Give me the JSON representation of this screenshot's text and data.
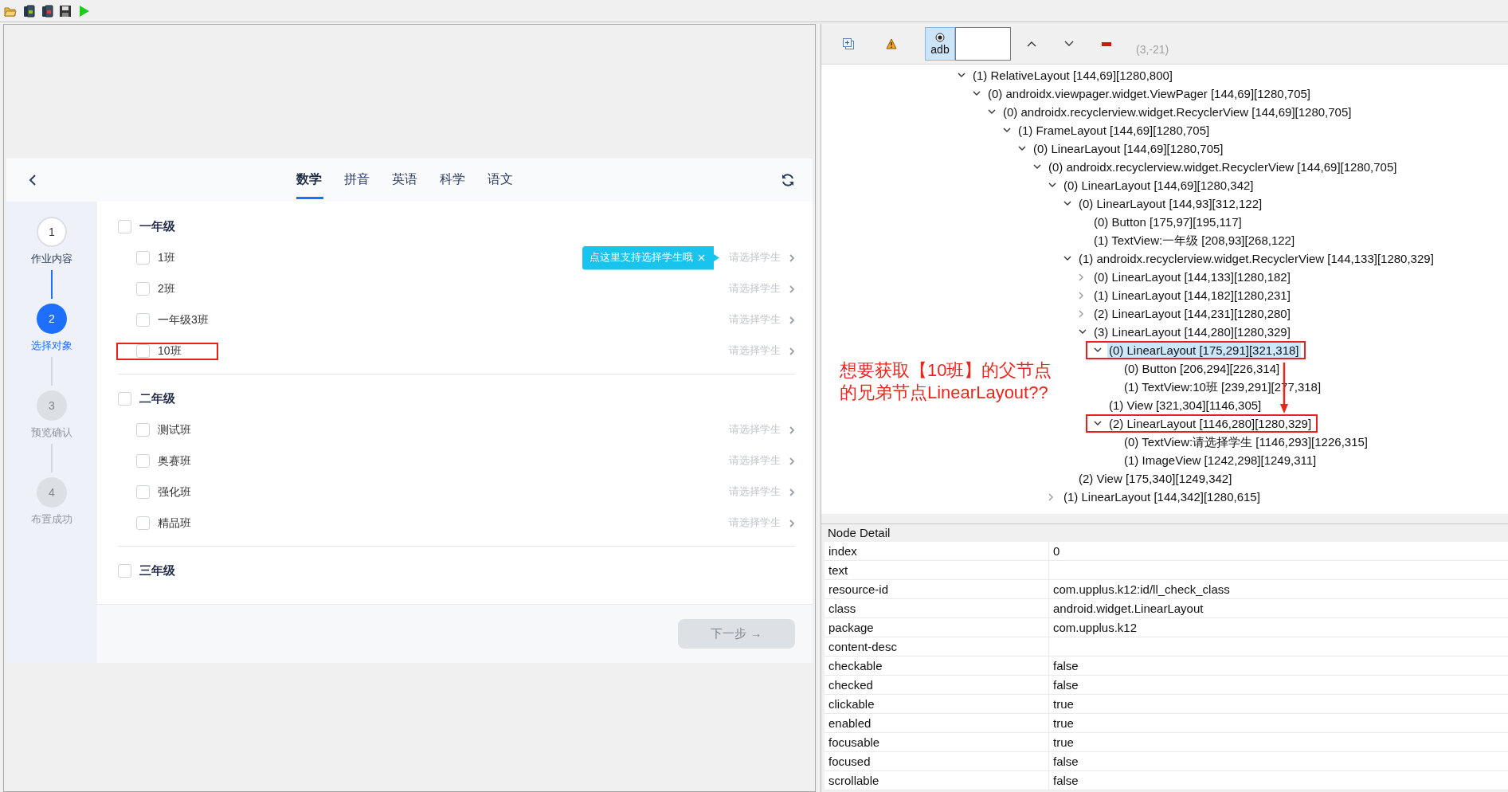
{
  "app": {
    "tabs": [
      {
        "label": "数学",
        "selected": true
      },
      {
        "label": "拼音",
        "selected": false
      },
      {
        "label": "英语",
        "selected": false
      },
      {
        "label": "科学",
        "selected": false
      },
      {
        "label": "语文",
        "selected": false
      }
    ],
    "steps": [
      {
        "number": "1",
        "label": "作业内容",
        "kind": "done"
      },
      {
        "number": "2",
        "label": "选择对象",
        "kind": "current"
      },
      {
        "number": "3",
        "label": "预览确认",
        "kind": "todo"
      },
      {
        "number": "4",
        "label": "布置成功",
        "kind": "todo"
      }
    ],
    "grades": [
      {
        "name": "一年级",
        "checked": false,
        "classes": [
          {
            "name": "1班",
            "checked": false,
            "hint": "请选择学生",
            "boxed": false,
            "tooltip": "点这里支持选择学生哦"
          },
          {
            "name": "2班",
            "checked": false,
            "hint": "请选择学生",
            "boxed": false
          },
          {
            "name": "一年级3班",
            "checked": false,
            "hint": "请选择学生",
            "boxed": false
          },
          {
            "name": "10班",
            "checked": false,
            "hint": "请选择学生",
            "boxed": true
          }
        ]
      },
      {
        "name": "二年级",
        "checked": false,
        "classes": [
          {
            "name": "测试班",
            "checked": false,
            "hint": "请选择学生",
            "boxed": false
          },
          {
            "name": "奥赛班",
            "checked": false,
            "hint": "请选择学生",
            "boxed": false
          },
          {
            "name": "强化班",
            "checked": false,
            "hint": "请选择学生",
            "boxed": false
          },
          {
            "name": "精品班",
            "checked": false,
            "hint": "请选择学生",
            "boxed": false
          }
        ]
      },
      {
        "name": "三年级",
        "checked": false
      }
    ],
    "next_button": {
      "label": "下一步 →",
      "disabled": true
    }
  },
  "inspector": {
    "toolbar": {
      "adb": {
        "label": "adb",
        "on": true
      },
      "coordinates": "(3,-21)"
    },
    "tree": [
      {
        "label": "(1) RelativeLayout [144,69][1280,800]",
        "expanded": true,
        "selected": false,
        "boxed": false,
        "children": [
          {
            "label": "(0) androidx.viewpager.widget.ViewPager [144,69][1280,705]",
            "expanded": true,
            "selected": false,
            "boxed": false,
            "children": [
              {
                "label": "(0) androidx.recyclerview.widget.RecyclerView [144,69][1280,705]",
                "expanded": true,
                "selected": false,
                "boxed": false,
                "children": [
                  {
                    "label": "(1) FrameLayout [144,69][1280,705]",
                    "expanded": true,
                    "selected": false,
                    "boxed": false,
                    "children": [
                      {
                        "label": "(0) LinearLayout [144,69][1280,705]",
                        "expanded": true,
                        "selected": false,
                        "boxed": false,
                        "children": [
                          {
                            "label": "(0) androidx.recyclerview.widget.RecyclerView [144,69][1280,705]",
                            "expanded": true,
                            "selected": false,
                            "boxed": false,
                            "children": [
                              {
                                "label": "(0) LinearLayout [144,69][1280,342]",
                                "expanded": true,
                                "selected": false,
                                "boxed": false,
                                "children": [
                                  {
                                    "label": "(0) LinearLayout [144,93][312,122]",
                                    "expanded": true,
                                    "selected": false,
                                    "boxed": false,
                                    "children": [
                                      {
                                        "label": "(0) Button [175,97][195,117]",
                                        "selected": false,
                                        "boxed": false
                                      },
                                      {
                                        "label": "(1) TextView:一年级 [208,93][268,122]",
                                        "selected": false,
                                        "boxed": false
                                      }
                                    ]
                                  },
                                  {
                                    "label": "(1) androidx.recyclerview.widget.RecyclerView [144,133][1280,329]",
                                    "expanded": true,
                                    "selected": false,
                                    "boxed": false,
                                    "children": [
                                      {
                                        "label": "(0) LinearLayout [144,133][1280,182]",
                                        "expanded": false,
                                        "selected": false,
                                        "boxed": false
                                      },
                                      {
                                        "label": "(1) LinearLayout [144,182][1280,231]",
                                        "expanded": false,
                                        "selected": false,
                                        "boxed": false
                                      },
                                      {
                                        "label": "(2) LinearLayout [144,231][1280,280]",
                                        "expanded": false,
                                        "selected": false,
                                        "boxed": false
                                      },
                                      {
                                        "label": "(3) LinearLayout [144,280][1280,329]",
                                        "expanded": true,
                                        "selected": false,
                                        "boxed": false,
                                        "children": [
                                          {
                                            "label": "(0) LinearLayout [175,291][321,318]",
                                            "expanded": true,
                                            "selected": true,
                                            "boxed": true,
                                            "children": [
                                              {
                                                "label": "(0) Button [206,294][226,314]",
                                                "selected": false,
                                                "boxed": false
                                              },
                                              {
                                                "label": "(1) TextView:10班 [239,291][277,318]",
                                                "selected": false,
                                                "boxed": false
                                              }
                                            ]
                                          },
                                          {
                                            "label": "(1) View [321,304][1146,305]",
                                            "selected": false,
                                            "boxed": false
                                          },
                                          {
                                            "label": "(2) LinearLayout [1146,280][1280,329]",
                                            "expanded": true,
                                            "selected": false,
                                            "boxed": true,
                                            "children": [
                                              {
                                                "label": "(0) TextView:请选择学生 [1146,293][1226,315]",
                                                "selected": false,
                                                "boxed": false
                                              },
                                              {
                                                "label": "(1) ImageView [1242,298][1249,311]",
                                                "selected": false,
                                                "boxed": false
                                              }
                                            ]
                                          }
                                        ]
                                      }
                                    ]
                                  },
                                  {
                                    "label": "(2) View [175,340][1249,342]",
                                    "selected": false,
                                    "boxed": false
                                  }
                                ]
                              },
                              {
                                "label": "(1) LinearLayout [144,342][1280,615]",
                                "expanded": false,
                                "selected": false,
                                "boxed": false
                              }
                            ]
                          }
                        ]
                      }
                    ]
                  }
                ]
              }
            ]
          }
        ]
      }
    ],
    "annotation": [
      "想要获取【10班】的父节点",
      "的兄弟节点LinearLayout??"
    ],
    "node_detail": {
      "title": "Node Detail",
      "rows": [
        {
          "key": "index",
          "value": "0"
        },
        {
          "key": "text"
        },
        {
          "key": "resource-id",
          "value": "com.upplus.k12:id/ll_check_class"
        },
        {
          "key": "class",
          "value": "android.widget.LinearLayout"
        },
        {
          "key": "package",
          "value": "com.upplus.k12"
        },
        {
          "key": "content-desc"
        },
        {
          "key": "checkable",
          "value": "false"
        },
        {
          "key": "checked",
          "value": "false"
        },
        {
          "key": "clickable",
          "value": "true"
        },
        {
          "key": "enabled",
          "value": "true"
        },
        {
          "key": "focusable",
          "value": "true"
        },
        {
          "key": "focused",
          "value": "false"
        },
        {
          "key": "scrollable",
          "value": "false"
        }
      ]
    }
  }
}
